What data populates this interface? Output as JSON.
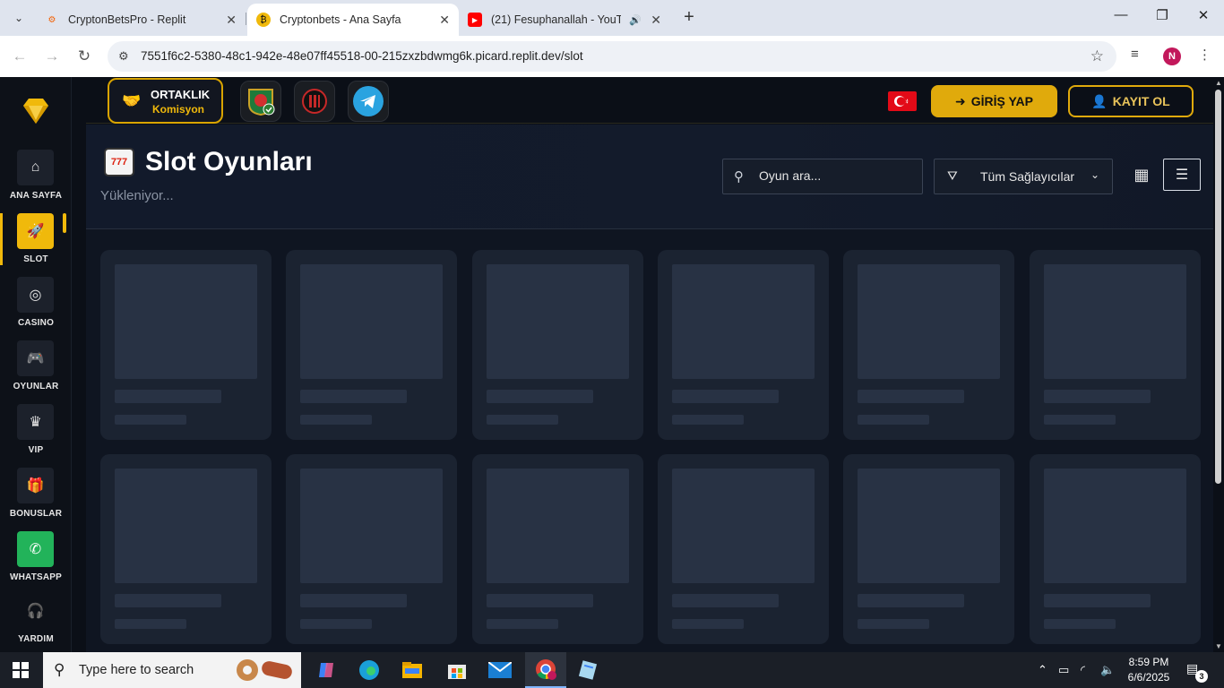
{
  "browser": {
    "tabs": [
      {
        "title": "CryptonBetsPro - Replit",
        "active": false
      },
      {
        "title": "Cryptonbets - Ana Sayfa",
        "active": true
      },
      {
        "title": "(21) Fesuphanallah - YouTube",
        "active": false
      }
    ],
    "url": "7551f6c2-5380-48c1-942e-48e07ff45518-00-215zxzbdwmg6k.picard.replit.dev/slot",
    "profile_initial": "N"
  },
  "sidebar": {
    "items": [
      {
        "label": "ANA SAYFA",
        "icon": "home-icon"
      },
      {
        "label": "SLOT",
        "icon": "rocket-icon"
      },
      {
        "label": "CASINO",
        "icon": "coins-icon"
      },
      {
        "label": "OYUNLAR",
        "icon": "gamepad-icon"
      },
      {
        "label": "VIP",
        "icon": "crown-icon"
      },
      {
        "label": "BONUSLAR",
        "icon": "gift-icon"
      },
      {
        "label": "WHATSAPP",
        "icon": "whatsapp-icon"
      },
      {
        "label": "YARDIM",
        "icon": "headset-icon"
      }
    ],
    "active_index": 1
  },
  "header": {
    "partner_title": "ORTAKLIK",
    "partner_sub": "Komisyon",
    "login_label": "GİRİŞ YAP",
    "register_label": "KAYIT OL"
  },
  "page": {
    "title": "Slot Oyunları",
    "subtitle": "Yükleniyor...",
    "search_placeholder": "Oyun ara...",
    "provider_label": "Tüm Sağlayıcılar"
  },
  "taskbar": {
    "search_placeholder": "Type here to search",
    "time": "8:59 PM",
    "date": "6/6/2025",
    "notifications": "3"
  },
  "colors": {
    "accent": "#f0b90b",
    "whatsapp": "#22b35a"
  }
}
